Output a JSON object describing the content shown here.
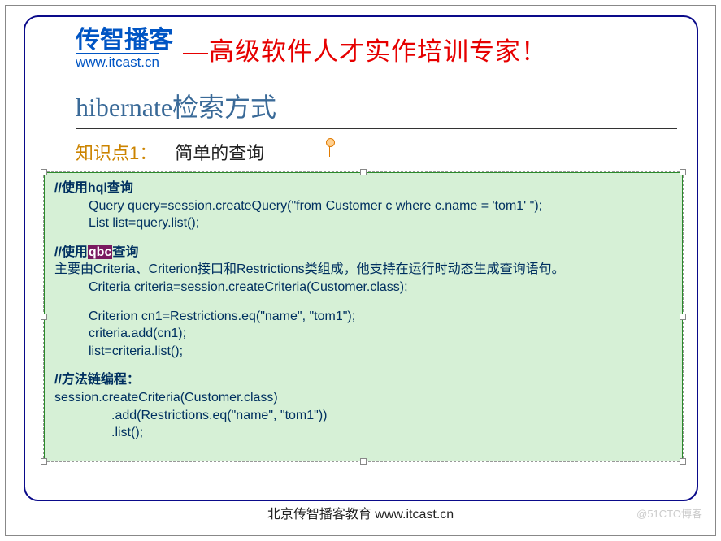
{
  "brand": {
    "text": "传智播客",
    "url": "www.itcast.cn"
  },
  "header": {
    "tagline": "—高级软件人才实作培训专家！"
  },
  "slide": {
    "title": "hibernate检索方式",
    "kp_label": "知识点1：",
    "kp_text": "简单的查询"
  },
  "code": {
    "c1": "//使用hql查询",
    "c2": "Query query=session.createQuery(\"from Customer c where c.name = 'tom1' \");",
    "c3": "List list=query.list();",
    "c4_pre": "//使用",
    "c4_hi": "qbc",
    "c4_post": "查询",
    "c5": "主要由Criteria、Criterion接口和Restrictions类组成，他支持在运行时动态生成查询语句。",
    "c6": "Criteria criteria=session.createCriteria(Customer.class);",
    "c7": "Criterion cn1=Restrictions.eq(\"name\", \"tom1\");",
    "c8": "criteria.add(cn1);",
    "c9": "list=criteria.list();",
    "c10": "//方法链编程：",
    "c11": "session.createCriteria(Customer.class)",
    "c12": ".add(Restrictions.eq(\"name\", \"tom1\"))",
    "c13": ".list();"
  },
  "footer": {
    "text": "北京传智播客教育 www.itcast.cn"
  },
  "watermark": "@51CTO博客"
}
